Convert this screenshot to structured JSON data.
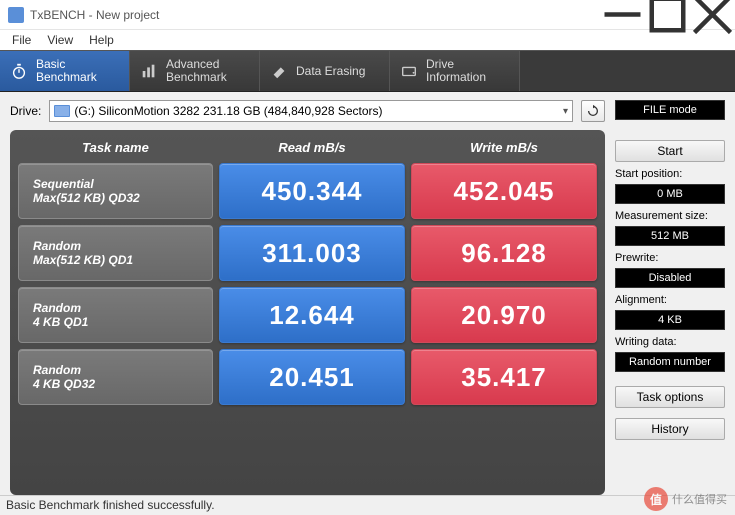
{
  "window": {
    "title": "TxBENCH - New project"
  },
  "menu": {
    "file": "File",
    "view": "View",
    "help": "Help"
  },
  "tabs": {
    "basic": "Basic\nBenchmark",
    "advanced": "Advanced\nBenchmark",
    "erase": "Data Erasing",
    "drive": "Drive\nInformation"
  },
  "drive": {
    "label": "Drive:",
    "value": "(G:) SiliconMotion 3282  231.18 GB (484,840,928 Sectors)"
  },
  "headers": {
    "task": "Task name",
    "read": "Read mB/s",
    "write": "Write mB/s"
  },
  "rows": [
    {
      "name": "Sequential",
      "sub": "Max(512 KB) QD32",
      "read": "450.344",
      "write": "452.045"
    },
    {
      "name": "Random",
      "sub": "Max(512 KB) QD1",
      "read": "311.003",
      "write": "96.128"
    },
    {
      "name": "Random",
      "sub": "4 KB QD1",
      "read": "12.644",
      "write": "20.970"
    },
    {
      "name": "Random",
      "sub": "4 KB QD32",
      "read": "20.451",
      "write": "35.417"
    }
  ],
  "side": {
    "filemode": "FILE mode",
    "start": "Start",
    "start_pos_label": "Start position:",
    "start_pos": "0 MB",
    "meas_label": "Measurement size:",
    "meas": "512 MB",
    "prewrite_label": "Prewrite:",
    "prewrite": "Disabled",
    "align_label": "Alignment:",
    "align": "4 KB",
    "wdata_label": "Writing data:",
    "wdata": "Random number",
    "taskopt": "Task options",
    "history": "History"
  },
  "status": "Basic Benchmark finished successfully.",
  "watermark": "什么值得买",
  "chart_data": {
    "type": "table",
    "title": "TxBENCH Basic Benchmark",
    "columns": [
      "Task name",
      "Read mB/s",
      "Write mB/s"
    ],
    "rows": [
      [
        "Sequential Max(512 KB) QD32",
        450.344,
        452.045
      ],
      [
        "Random Max(512 KB) QD1",
        311.003,
        96.128
      ],
      [
        "Random 4 KB QD1",
        12.644,
        20.97
      ],
      [
        "Random 4 KB QD32",
        20.451,
        35.417
      ]
    ]
  }
}
